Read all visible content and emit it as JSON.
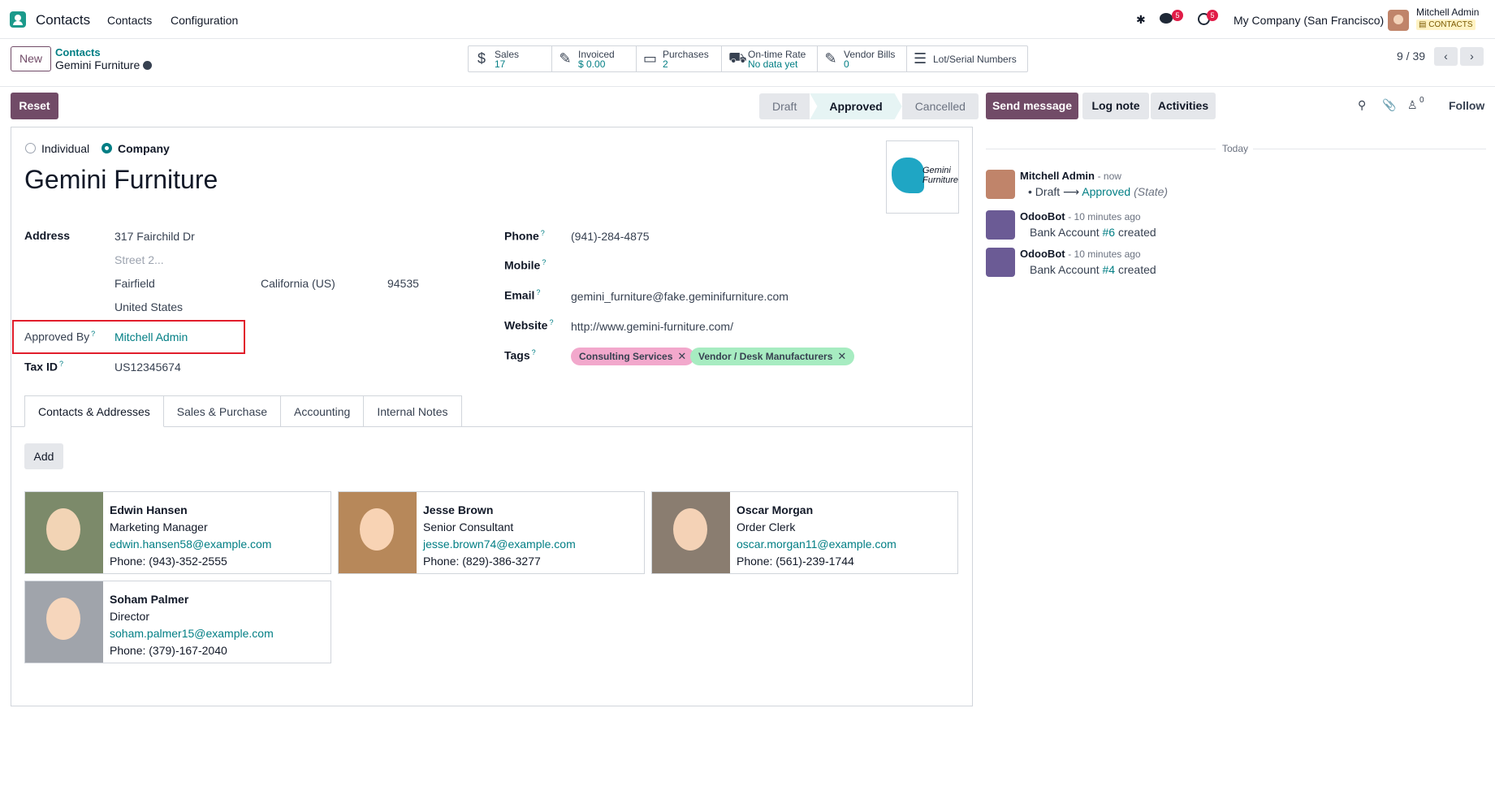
{
  "navbar": {
    "app_name": "Contacts",
    "menu": [
      "Contacts",
      "Configuration"
    ],
    "messages_count": "5",
    "activities_count": "5",
    "company": "My Company (San Francisco)",
    "user_name": "Mitchell Admin",
    "database": "CONTACTS"
  },
  "control": {
    "new_label": "New",
    "breadcrumb_parent": "Contacts",
    "breadcrumb_current": "Gemini Furniture",
    "pager": "9 / 39",
    "smart_buttons": [
      {
        "icon": "dollar-icon",
        "label": "Sales",
        "value": "17"
      },
      {
        "icon": "invoice-icon",
        "label": "Invoiced",
        "value": "$ 0.00"
      },
      {
        "icon": "card-icon",
        "label": "Purchases",
        "value": "2"
      },
      {
        "icon": "truck-icon",
        "label": "On-time Rate",
        "value": "No data yet"
      },
      {
        "icon": "edit-icon",
        "label": "Vendor Bills",
        "value": "0"
      },
      {
        "icon": "list-icon",
        "label": "Lot/Serial Numbers",
        "value": ""
      }
    ]
  },
  "form": {
    "reset_label": "Reset",
    "stages": [
      "Draft",
      "Approved",
      "Cancelled"
    ],
    "active_stage": "Approved",
    "type_options": [
      "Individual",
      "Company"
    ],
    "type_selected": "Company",
    "name": "Gemini Furniture",
    "logo_text": "Gemini Furniture",
    "address_label": "Address",
    "street": "317 Fairchild Dr",
    "street2_placeholder": "Street 2...",
    "city": "Fairfield",
    "state": "California (US)",
    "zip": "94535",
    "country": "United States",
    "approved_by_label": "Approved By",
    "approved_by": "Mitchell Admin",
    "tax_id_label": "Tax ID",
    "tax_id": "US12345674",
    "phone_label": "Phone",
    "phone": "(941)-284-4875",
    "mobile_label": "Mobile",
    "email_label": "Email",
    "email": "gemini_furniture@fake.geminifurniture.com",
    "website_label": "Website",
    "website": "http://www.gemini-furniture.com/",
    "tags_label": "Tags",
    "tags": [
      {
        "label": "Consulting Services",
        "color": "#f2a8cc"
      },
      {
        "label": "Vendor / Desk Manufacturers",
        "color": "#a7ecc1"
      }
    ],
    "tabs": [
      "Contacts & Addresses",
      "Sales & Purchase",
      "Accounting",
      "Internal Notes"
    ],
    "add_label": "Add",
    "contacts": [
      {
        "name": "Edwin Hansen",
        "function": "Marketing Manager",
        "email": "edwin.hansen58@example.com",
        "phone": "Phone: (943)-352-2555",
        "photo_color": "#7c8a6a"
      },
      {
        "name": "Jesse Brown",
        "function": "Senior Consultant",
        "email": "jesse.brown74@example.com",
        "phone": "Phone: (829)-386-3277",
        "photo_color": "#b7885a"
      },
      {
        "name": "Oscar Morgan",
        "function": "Order Clerk",
        "email": "oscar.morgan11@example.com",
        "phone": "Phone: (561)-239-1744",
        "photo_color": "#8a7d70"
      },
      {
        "name": "Soham Palmer",
        "function": "Director",
        "email": "soham.palmer15@example.com",
        "phone": "Phone: (379)-167-2040",
        "photo_color": "#a0a4ab"
      }
    ]
  },
  "chatter": {
    "send_message": "Send message",
    "log_note": "Log note",
    "activities": "Activities",
    "followers_count": "0",
    "follow": "Follow",
    "date_separator": "Today",
    "messages": [
      {
        "author": "Mitchell Admin",
        "time": "- now",
        "body_from": "Draft",
        "arrow": "⟶",
        "body_to": "Approved",
        "field": "(State)"
      },
      {
        "author": "OdooBot",
        "time": "- 10 minutes ago",
        "prefix": "Bank Account",
        "ref": "#6",
        "suffix": "created"
      },
      {
        "author": "OdooBot",
        "time": "- 10 minutes ago",
        "prefix": "Bank Account",
        "ref": "#4",
        "suffix": "created"
      }
    ]
  }
}
